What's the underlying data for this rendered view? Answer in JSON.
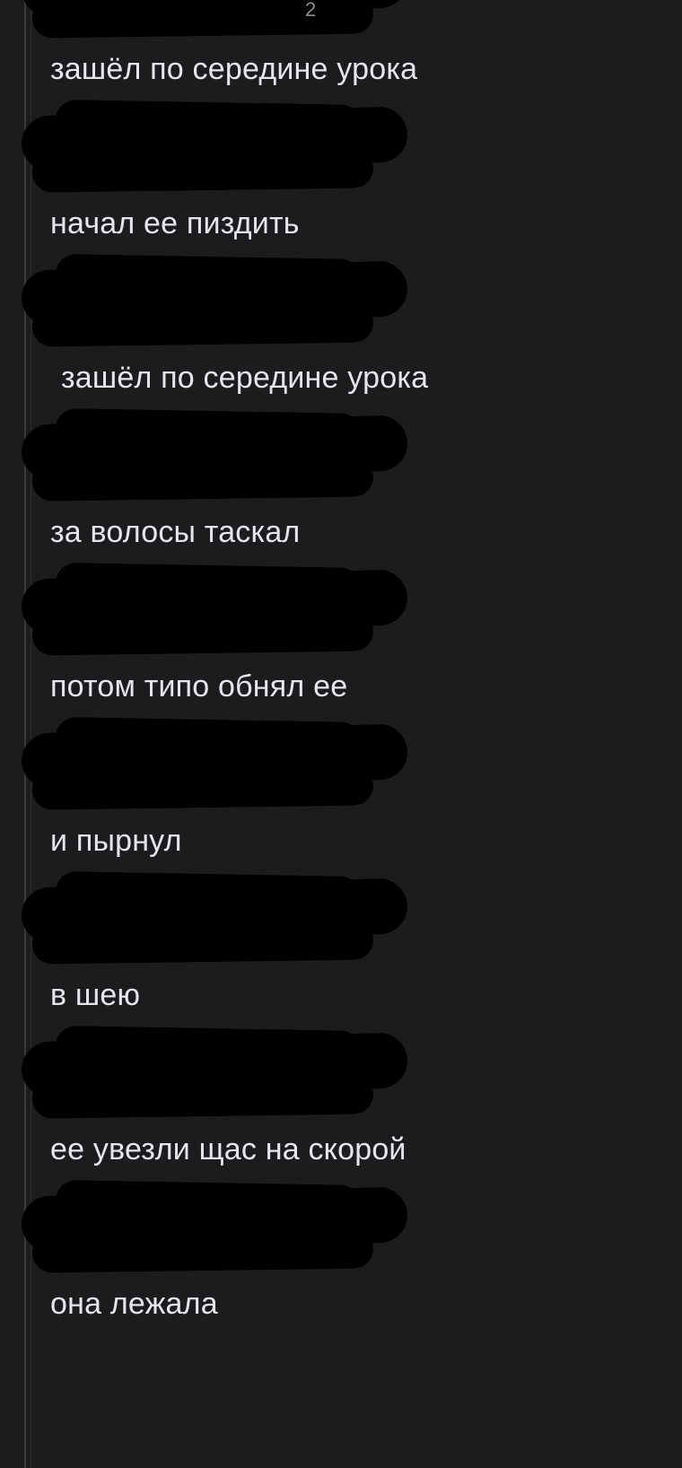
{
  "thread": {
    "messages": [
      {
        "author_visible": "2",
        "text": "зашёл по середине урока"
      },
      {
        "author_visible": "",
        "text": "начал ее пиздить"
      },
      {
        "author_visible": "",
        "text": "зашёл по середине урока"
      },
      {
        "author_visible": "",
        "text": "за волосы таскал"
      },
      {
        "author_visible": "",
        "text": "потом типо обнял ее"
      },
      {
        "author_visible": "",
        "text": "и пырнул"
      },
      {
        "author_visible": "",
        "text": "в шею"
      },
      {
        "author_visible": "",
        "text": "ее увезли щас на скорой"
      },
      {
        "author_visible": "",
        "text": "она лежала"
      }
    ]
  },
  "colors": {
    "background": "#1c1c1e",
    "text": "#e5e5ea",
    "redaction": "#000000"
  }
}
